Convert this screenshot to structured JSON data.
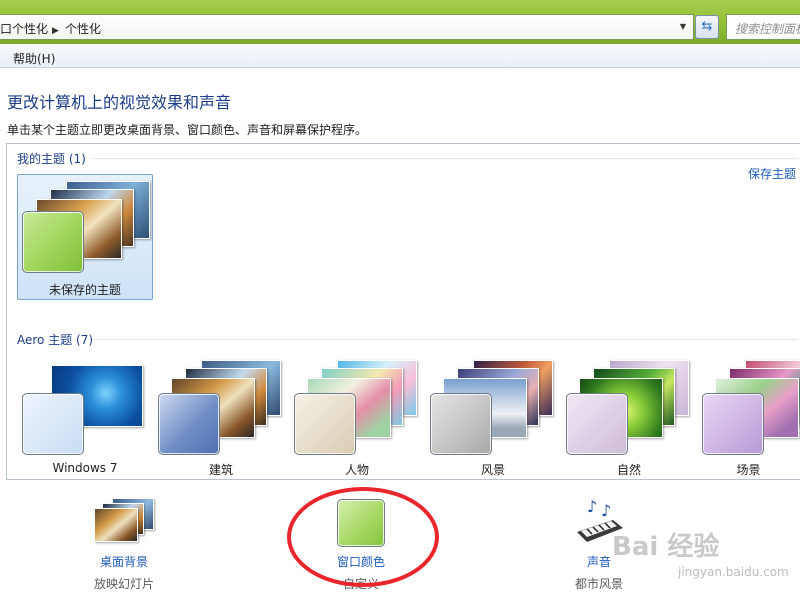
{
  "address_bar": {
    "path": [
      "口个性化",
      "个性化"
    ],
    "search_placeholder": "搜索控制面板"
  },
  "menu": {
    "help": "帮助(H)"
  },
  "header": {
    "title": "更改计算机上的视觉效果和声音",
    "description": "单击某个主题立即更改桌面背景、窗口颜色、声音和屏幕保护程序。"
  },
  "my_themes": {
    "title": "我的主题 (1)",
    "items": [
      {
        "label": "未保存的主题"
      }
    ],
    "save_link": "保存主题"
  },
  "aero_themes": {
    "title": "Aero 主题 (7)",
    "items": [
      {
        "label": "Windows 7"
      },
      {
        "label": "建筑"
      },
      {
        "label": "人物"
      },
      {
        "label": "风景"
      },
      {
        "label": "自然"
      },
      {
        "label": "场景"
      }
    ]
  },
  "bottom": {
    "desktop_background": {
      "label": "桌面背景",
      "sub": "放映幻灯片"
    },
    "window_color": {
      "label": "窗口颜色",
      "sub": "自定义"
    },
    "sound": {
      "label": "声音",
      "sub": "都市风景"
    }
  },
  "watermark": {
    "brand": "Bai 经验",
    "url": "jingyan.baidu.com"
  },
  "colors": {
    "accent_link": "#1e5bb8",
    "title_blue": "#1e3e8a",
    "window_chrome": "#8fbd35",
    "annotation_red": "#e8262b"
  }
}
